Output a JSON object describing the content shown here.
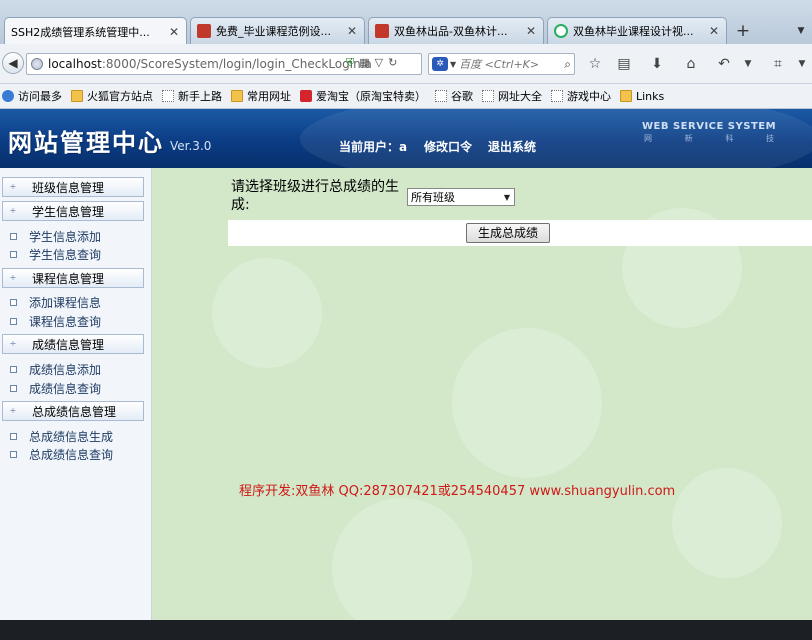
{
  "browser": {
    "tabs": [
      {
        "label": "SSH2成绩管理系统管理中...",
        "active": true,
        "favicon_color": "#f4f6f9"
      },
      {
        "label": "免费_毕业课程范例设...",
        "active": false,
        "favicon_color": "#c0392b"
      },
      {
        "label": "双鱼林出品-双鱼林计...",
        "active": false,
        "favicon_color": "#c0392b"
      },
      {
        "label": "双鱼林毕业课程设计视...",
        "active": false,
        "favicon_color": "#27ae60"
      }
    ],
    "new_tab_symbol": "+",
    "url_host": "localhost",
    "url_path": ":8000/ScoreSystem/login/login_CheckLogin.a",
    "search_placeholder": "百度 <Ctrl+K>",
    "bookmarks": [
      {
        "label": "访问最多",
        "icon": "gear-icon"
      },
      {
        "label": "火狐官方站点",
        "icon": "folder-icon"
      },
      {
        "label": "新手上路",
        "icon": "page-icon"
      },
      {
        "label": "常用网址",
        "icon": "folder-icon"
      },
      {
        "label": "爱淘宝（原淘宝特卖）",
        "icon": "taobao-icon"
      },
      {
        "label": "谷歌",
        "icon": "page-icon"
      },
      {
        "label": "网址大全",
        "icon": "page-icon"
      },
      {
        "label": "游戏中心",
        "icon": "page-icon"
      },
      {
        "label": "Links",
        "icon": "folder-icon"
      }
    ]
  },
  "header": {
    "site_title": "网站管理中心",
    "version": "Ver.3.0",
    "current_user_label": "当前用户：a",
    "change_password": "修改口令",
    "logout": "退出系统",
    "service_title": "WEB SERVICE SYSTEM",
    "service_sub": [
      "网",
      "新",
      "科",
      "技"
    ]
  },
  "sidebar": {
    "groups": [
      {
        "title": "班级信息管理",
        "items": []
      },
      {
        "title": "学生信息管理",
        "items": [
          "学生信息添加",
          "学生信息查询"
        ]
      },
      {
        "title": "课程信息管理",
        "items": [
          "添加课程信息",
          "课程信息查询"
        ]
      },
      {
        "title": "成绩信息管理",
        "items": [
          "成绩信息添加",
          "成绩信息查询"
        ]
      },
      {
        "title": "总成绩信息管理",
        "items": [
          "总成绩信息生成",
          "总成绩信息查询"
        ]
      }
    ]
  },
  "main": {
    "select_prompt": "请选择班级进行总成绩的生成:",
    "class_select_value": "所有班级",
    "generate_button": "生成总成绩",
    "footer_credit": "程序开发:双鱼林 QQ:287307421或254540457 www.shuangyulin.com"
  },
  "colors": {
    "header_blue": "#0b3c84",
    "content_green": "#d2e8c9",
    "credit_red": "#d01818"
  }
}
